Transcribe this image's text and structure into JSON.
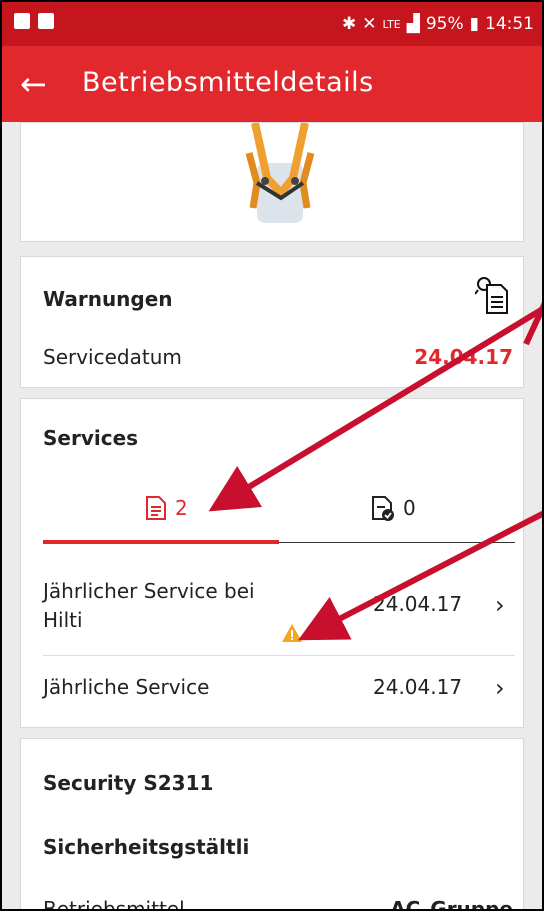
{
  "status_bar": {
    "battery": "95%",
    "time": "14:51",
    "signal": "LTE"
  },
  "app_bar": {
    "title": "Betriebsmitteldetails"
  },
  "warnings": {
    "title": "Warnungen",
    "service_label": "Servicedatum",
    "service_date": "24.04.17"
  },
  "services": {
    "title": "Services",
    "tabs": [
      {
        "count": "2"
      },
      {
        "count": "0"
      }
    ],
    "rows": [
      {
        "label": "Jährlicher Service bei Hilti",
        "date": "24.04.17"
      },
      {
        "label": "Jährliche Service",
        "date": "24.04.17"
      }
    ]
  },
  "security": {
    "title": "Security S2311",
    "subtitle": "Sicherheitsgstältli",
    "betriebsmittel_label": "Betriebsmittel",
    "betriebsmittel_value": "AC_Gruppe"
  },
  "colors": {
    "accent": "#e1282d",
    "warning": "#f5a623",
    "arrow": "#c8102e"
  }
}
